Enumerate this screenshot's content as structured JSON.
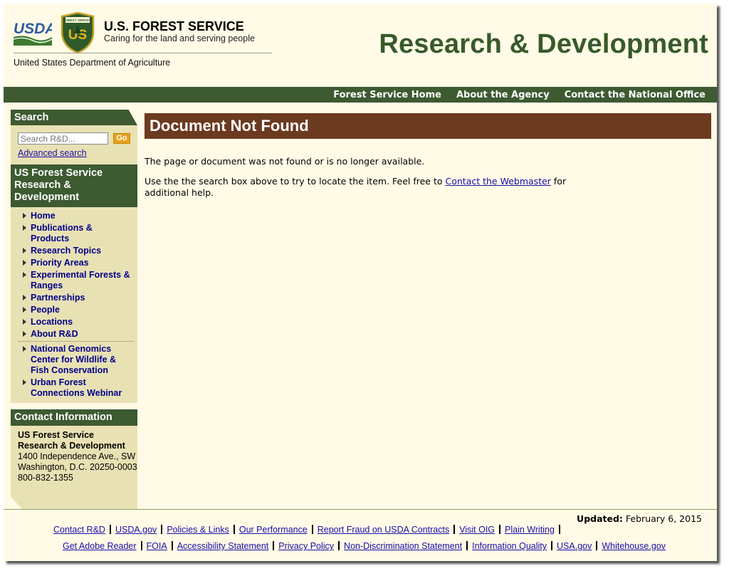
{
  "header": {
    "usda_text": "USDA",
    "shield_text": "US",
    "shield_top_text": "FOREST SERVICE",
    "agency_name": "U.S. FOREST SERVICE",
    "agency_tagline": "Caring for the land and serving people",
    "department": "United States Department of Agriculture",
    "site_title": "Research & Development"
  },
  "top_nav": [
    "Forest Service Home",
    "About the Agency",
    "Contact the National Office"
  ],
  "sidebar": {
    "search_heading": "Search",
    "search_placeholder": "Search R&D...",
    "go_label": "Go",
    "advanced_search": "Advanced search",
    "section_heading": "US Forest Service Research & Development",
    "nav_items": [
      "Home",
      "Publications & Products",
      "Research Topics",
      "Priority Areas",
      "Experimental Forests & Ranges",
      "Partnerships",
      "People",
      "Locations",
      "About R&D"
    ],
    "extra_items": [
      "National Genomics Center for Wildlife & Fish Conservation",
      "Urban Forest Connections Webinar"
    ],
    "contact_heading": "Contact Information",
    "contact_org1": "US Forest Service",
    "contact_org2": "Research & Development",
    "contact_address1": "1400 Independence Ave., SW",
    "contact_address2": "Washington, D.C. 20250-0003",
    "contact_phone": "800-832-1355"
  },
  "main": {
    "heading": "Document Not Found",
    "para1": "The page or document was not found or is no longer available.",
    "para2_before": "Use the the search box above to try to locate the item. Feel free to ",
    "para2_link": "Contact the Webmaster",
    "para2_after": " for additional help."
  },
  "footer": {
    "updated_label": "Updated:",
    "updated_date": "February 6, 2015",
    "row1": [
      "Contact R&D",
      "USDA.gov",
      "Policies & Links",
      "Our Performance",
      "Report Fraud on USDA Contracts",
      "Visit OIG",
      "Plain Writing"
    ],
    "row2": [
      "Get Adobe Reader",
      "FOIA",
      "Accessibility Statement",
      "Privacy Policy",
      "Non-Discrimination Statement",
      "Information Quality",
      "USA.gov",
      "Whitehouse.gov"
    ]
  },
  "colors": {
    "forest_green": "#3d5a30",
    "title_green": "#385a2a",
    "heading_brown": "#6b3a1f",
    "sidebar_tan": "#e8e1b4",
    "page_cream": "#fffbe6",
    "go_orange": "#e7a31c"
  }
}
